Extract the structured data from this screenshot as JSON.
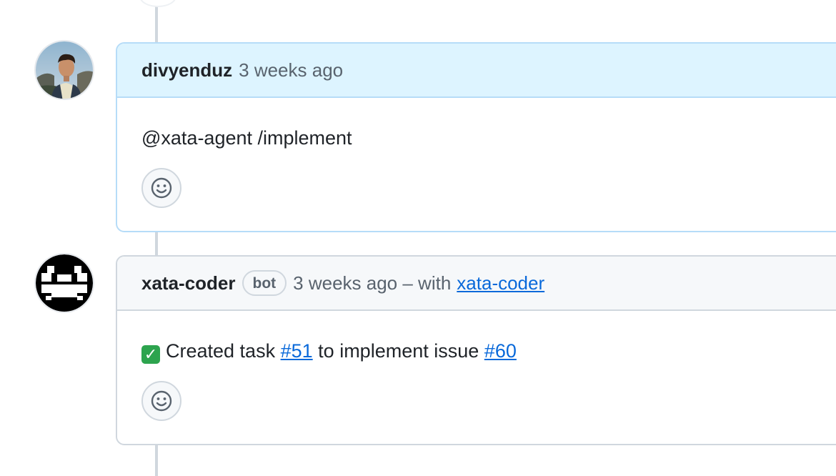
{
  "comments": [
    {
      "author": "divyenduz",
      "timestamp": "3 weeks ago",
      "body": "@xata-agent /implement",
      "avatar_icon": "user-photo-avatar",
      "accent": "#ddf4ff"
    },
    {
      "author": "xata-coder",
      "badge": "bot",
      "timestamp": "3 weeks ago – with",
      "app_link": "xata-coder",
      "avatar_icon": "pixel-identicon-avatar",
      "accent": "#f6f8fa",
      "body": {
        "status_icon": "check-mark-emoji",
        "text_1": "Created task",
        "task_link": "#51",
        "text_2": "to implement issue",
        "issue_link": "#60"
      }
    }
  ],
  "reaction_icon": "smiley-icon",
  "colors": {
    "link": "#0969da",
    "timeline": "#d0d7de",
    "highlight_border": "#b6dcf8"
  }
}
